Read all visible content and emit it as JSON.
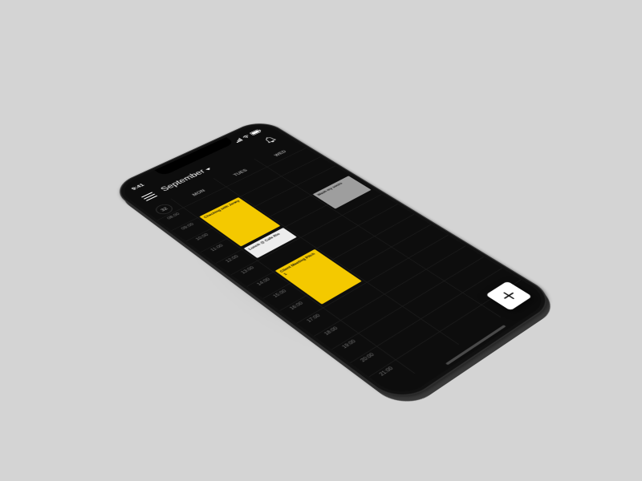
{
  "status": {
    "time": "9:41"
  },
  "header": {
    "month": "September"
  },
  "week_number": "32",
  "days": [
    "MON",
    "TUES",
    "WED"
  ],
  "hours": [
    "08:00",
    "09:00",
    "10:00",
    "11:00",
    "12:00",
    "13:00",
    "14:00",
    "15:00",
    "16:00",
    "17:00",
    "18:00",
    "19:00",
    "20:00",
    "21:00"
  ],
  "events": {
    "e1": {
      "title": "Checking with Jenny"
    },
    "e2": {
      "title": "Lunch @ Cafe Rio"
    },
    "e3": {
      "title": "Client Meeting Pitch 1"
    },
    "e4": {
      "title": "Wash my socks"
    }
  },
  "colors": {
    "accent": "#f4c900",
    "card_white": "#ededed",
    "card_grey": "#9e9e9e",
    "bg": "#0d0d0d"
  }
}
